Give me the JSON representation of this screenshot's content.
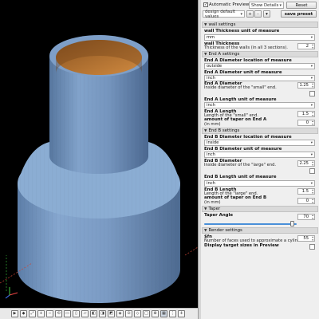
{
  "toolbar": {
    "automatic_preview": "Automatic Preview",
    "automatic_preview_checked": true,
    "details_mode": "Show Details",
    "reset_label": "Reset",
    "preset_value": "design default values",
    "plus_label": "+",
    "minus_label": "-",
    "save_preset_label": "save preset"
  },
  "sections": {
    "wall": {
      "title": "wall settings",
      "unit_label": "wall Thickness unit of measure",
      "unit_value": "mm",
      "thickness_label": "wall Thickness",
      "thickness_desc": "Thickness of the walls (in all 3 sections).",
      "thickness_value": "2"
    },
    "end_a": {
      "title": "End A settings",
      "diam_loc_label": "End A Diameter location of measure",
      "diam_loc_value": "outside",
      "diam_unit_label": "End A Diameter unit of measure",
      "diam_unit_value": "inch",
      "diam_label": "End A Diameter",
      "diam_desc": "Inside diameter of the \"small\" end.",
      "diam_value": "1.25",
      "length_unit_label": "End A Length unit of measure",
      "length_unit_value": "inch",
      "length_label": "End A Length",
      "length_desc": "Length of the \"small\" end.",
      "length_value": "1.5",
      "taper_label": "amount of taper on End A",
      "taper_desc": "(in mm)",
      "taper_value": "0"
    },
    "end_b": {
      "title": "End B settings",
      "diam_loc_label": "End B Diameter location of measure",
      "diam_loc_value": "inside",
      "diam_unit_label": "End B Diameter unit of measure",
      "diam_unit_value": "inch",
      "diam_label": "End B Diameter",
      "diam_desc": "Inside diameter of the \"large\" end.",
      "diam_value": "2.25",
      "length_unit_label": "End B Length unit of measure",
      "length_unit_value": "inch",
      "length_label": "End B Length",
      "length_desc": "Length of the \"large\" end.",
      "length_value": "1.5",
      "taper_label": "amount of taper on End B",
      "taper_desc": "(in mm)",
      "taper_value": "0"
    },
    "taper": {
      "title": "Taper",
      "angle_label": "Taper Angle",
      "angle_value": "70",
      "angle_fraction": 0.95
    },
    "render": {
      "title": "Render settings",
      "fn_label": "$fn",
      "fn_desc": "Number of faces used to approximate a cylinder",
      "fn_value": "55",
      "display_label": "Display target sizes in Preview"
    }
  },
  "viewport_toolbar": {
    "icons": [
      "preview-icon",
      "render-icon",
      "zoom-all-icon",
      "zoom-in-icon",
      "zoom-out-icon",
      "reset-view-icon",
      "right-view-icon",
      "top-view-icon",
      "bottom-view-icon",
      "left-view-icon",
      "front-view-icon",
      "back-view-icon",
      "diagonal-view-icon",
      "center-view-icon",
      "perspective-icon",
      "orthogonal-icon",
      "show-axes-icon",
      "show-edges-icon",
      "scale-markers-icon",
      "crosshairs-icon"
    ]
  },
  "colors": {
    "model_fill": "#7a9ac4",
    "model_inner": "#b9742e",
    "viewport_bg": "#000000",
    "accent": "#4a90d9"
  }
}
